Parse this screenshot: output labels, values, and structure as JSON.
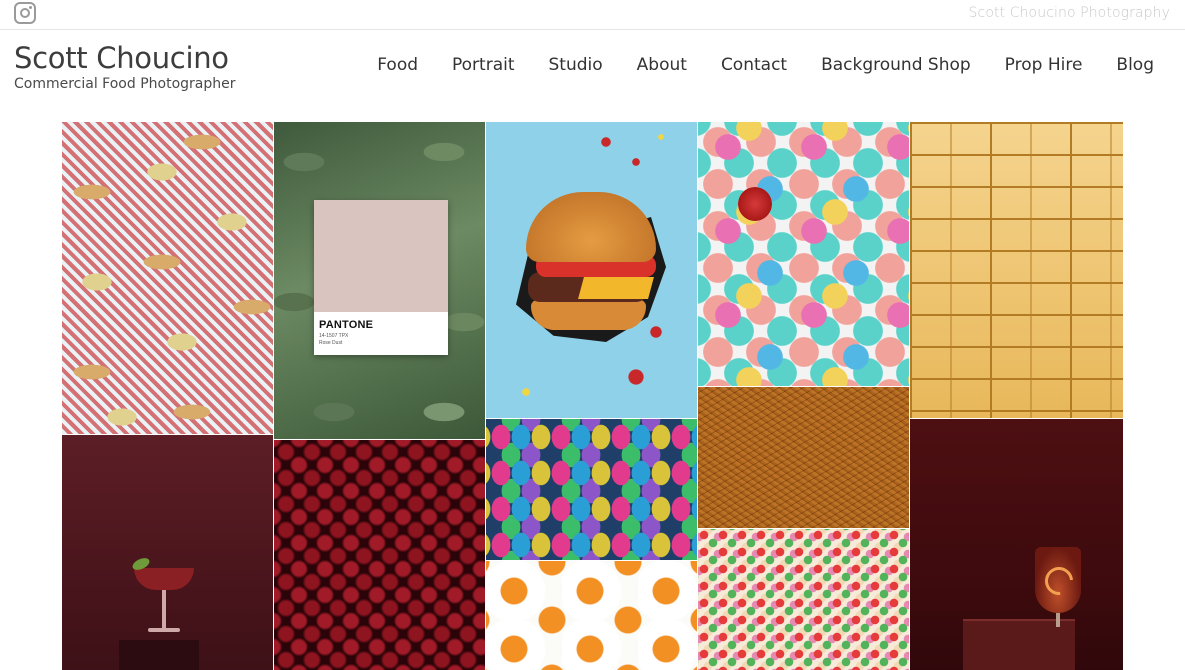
{
  "topbar": {
    "icon": "instagram-icon",
    "site_label": "Scott Choucino Photography"
  },
  "header": {
    "name": "Scott Choucino",
    "tagline": "Commercial Food Photographer"
  },
  "nav": {
    "items": [
      {
        "label": "Food"
      },
      {
        "label": "Portrait"
      },
      {
        "label": "Studio"
      },
      {
        "label": "About"
      },
      {
        "label": "Contact"
      },
      {
        "label": "Background Shop"
      },
      {
        "label": "Prop Hire"
      },
      {
        "label": "Blog"
      }
    ]
  },
  "gallery": {
    "pantone": {
      "brand": "PANTONE",
      "code": "14-1507 TPX",
      "color_name": "Rose Dust"
    }
  },
  "colors": {
    "text": "#333333",
    "muted": "#c8c8c8",
    "divider": "#e4e4e4"
  }
}
